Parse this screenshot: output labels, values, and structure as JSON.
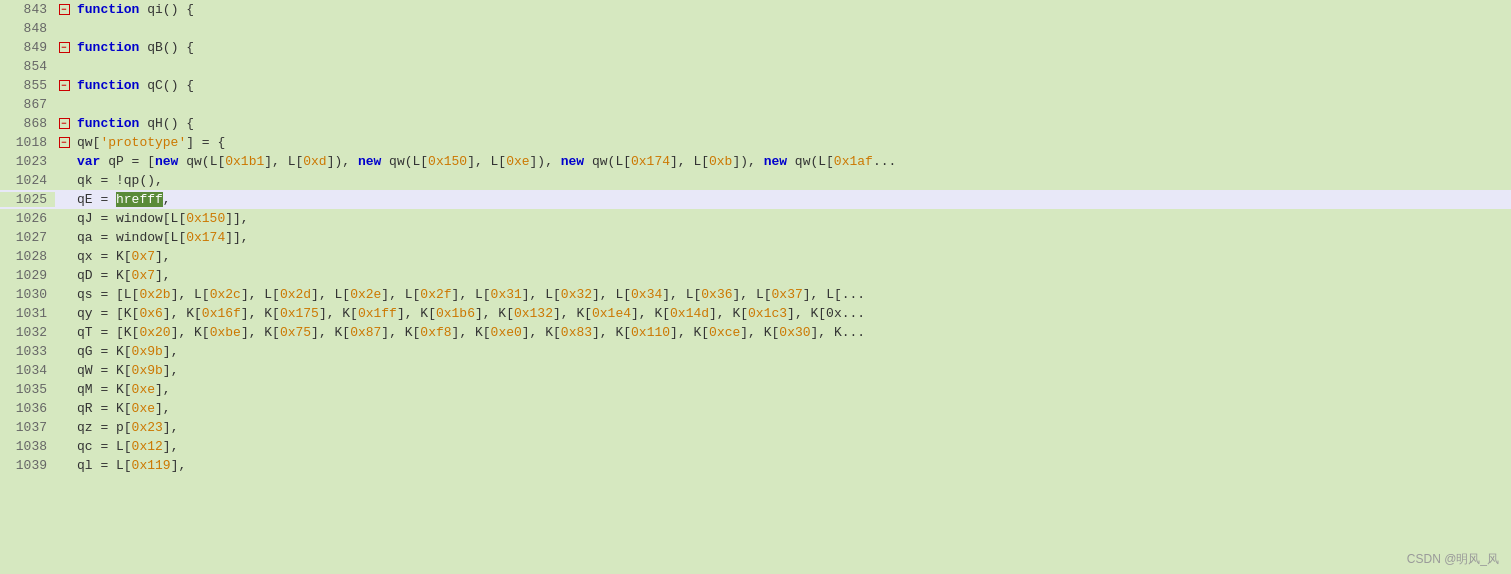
{
  "editor": {
    "lines": [
      {
        "num": "843",
        "fold": true,
        "indent": "                        ",
        "content": [
          {
            "type": "kw",
            "text": "function"
          },
          {
            "type": "plain",
            "text": " qi() {"
          }
        ]
      },
      {
        "num": "848",
        "fold": false,
        "indent": "",
        "content": []
      },
      {
        "num": "849",
        "fold": true,
        "indent": "                        ",
        "content": [
          {
            "type": "kw",
            "text": "function"
          },
          {
            "type": "plain",
            "text": " qB() {"
          }
        ]
      },
      {
        "num": "854",
        "fold": false,
        "indent": "",
        "content": []
      },
      {
        "num": "855",
        "fold": true,
        "indent": "                        ",
        "content": [
          {
            "type": "kw",
            "text": "function"
          },
          {
            "type": "plain",
            "text": " qC() {"
          }
        ]
      },
      {
        "num": "867",
        "fold": false,
        "indent": "",
        "content": []
      },
      {
        "num": "868",
        "fold": true,
        "indent": "                        ",
        "content": [
          {
            "type": "kw",
            "text": "function"
          },
          {
            "type": "plain",
            "text": " qH() {"
          }
        ]
      },
      {
        "num": "1018",
        "fold": true,
        "indent": "                        ",
        "content": [
          {
            "type": "plain",
            "text": "qw["
          },
          {
            "type": "str",
            "text": "'prototype'"
          },
          {
            "type": "plain",
            "text": "] = {"
          }
        ]
      },
      {
        "num": "1023",
        "fold": false,
        "indent": "                            ",
        "content": [
          {
            "type": "kw",
            "text": "var"
          },
          {
            "type": "plain",
            "text": " qP = ["
          },
          {
            "type": "kw",
            "text": "new"
          },
          {
            "type": "plain",
            "text": " qw(L["
          },
          {
            "type": "hex",
            "text": "0x1b1"
          },
          {
            "type": "plain",
            "text": "], L["
          },
          {
            "type": "hex",
            "text": "0xd"
          },
          {
            "type": "plain",
            "text": "]),  "
          },
          {
            "type": "kw",
            "text": "new"
          },
          {
            "type": "plain",
            "text": " qw(L["
          },
          {
            "type": "hex",
            "text": "0x150"
          },
          {
            "type": "plain",
            "text": "], L["
          },
          {
            "type": "hex",
            "text": "0xe"
          },
          {
            "type": "plain",
            "text": "]),  "
          },
          {
            "type": "kw",
            "text": "new"
          },
          {
            "type": "plain",
            "text": " qw(L["
          },
          {
            "type": "hex",
            "text": "0x174"
          },
          {
            "type": "plain",
            "text": "], L["
          },
          {
            "type": "hex",
            "text": "0xb"
          },
          {
            "type": "plain",
            "text": "]),  "
          },
          {
            "type": "kw",
            "text": "new"
          },
          {
            "type": "plain",
            "text": " qw(L["
          },
          {
            "type": "hex",
            "text": "0x1af"
          },
          {
            "type": "plain",
            "text": "..."
          }
        ]
      },
      {
        "num": "1024",
        "fold": false,
        "indent": "                                ",
        "content": [
          {
            "type": "plain",
            "text": "qk = !qp(),"
          }
        ]
      },
      {
        "num": "1025",
        "fold": false,
        "indent": "                                ",
        "highlight": true,
        "content": [
          {
            "type": "plain",
            "text": "qE = "
          },
          {
            "type": "highlight",
            "text": "hrefff"
          },
          {
            "type": "plain",
            "text": ","
          }
        ]
      },
      {
        "num": "1026",
        "fold": false,
        "indent": "                                ",
        "content": [
          {
            "type": "plain",
            "text": "qJ = window[L["
          },
          {
            "type": "hex",
            "text": "0x150"
          },
          {
            "type": "plain",
            "text": "]],"
          }
        ]
      },
      {
        "num": "1027",
        "fold": false,
        "indent": "                                ",
        "content": [
          {
            "type": "plain",
            "text": "qa = window[L["
          },
          {
            "type": "hex",
            "text": "0x174"
          },
          {
            "type": "plain",
            "text": "]],"
          }
        ]
      },
      {
        "num": "1028",
        "fold": false,
        "indent": "                                ",
        "content": [
          {
            "type": "plain",
            "text": "qx = K["
          },
          {
            "type": "hex",
            "text": "0x7"
          },
          {
            "type": "plain",
            "text": "],"
          }
        ]
      },
      {
        "num": "1029",
        "fold": false,
        "indent": "                                ",
        "content": [
          {
            "type": "plain",
            "text": "qD = K["
          },
          {
            "type": "hex",
            "text": "0x7"
          },
          {
            "type": "plain",
            "text": "],"
          }
        ]
      },
      {
        "num": "1030",
        "fold": false,
        "indent": "                                ",
        "content": [
          {
            "type": "plain",
            "text": "qs = [L["
          },
          {
            "type": "hex",
            "text": "0x2b"
          },
          {
            "type": "plain",
            "text": "], L["
          },
          {
            "type": "hex",
            "text": "0x2c"
          },
          {
            "type": "plain",
            "text": "], L["
          },
          {
            "type": "hex",
            "text": "0x2d"
          },
          {
            "type": "plain",
            "text": "], L["
          },
          {
            "type": "hex",
            "text": "0x2e"
          },
          {
            "type": "plain",
            "text": "], L["
          },
          {
            "type": "hex",
            "text": "0x2f"
          },
          {
            "type": "plain",
            "text": "], L["
          },
          {
            "type": "hex",
            "text": "0x31"
          },
          {
            "type": "plain",
            "text": "], L["
          },
          {
            "type": "hex",
            "text": "0x32"
          },
          {
            "type": "plain",
            "text": "], L["
          },
          {
            "type": "hex",
            "text": "0x34"
          },
          {
            "type": "plain",
            "text": "], L["
          },
          {
            "type": "hex",
            "text": "0x36"
          },
          {
            "type": "plain",
            "text": "], L["
          },
          {
            "type": "hex",
            "text": "0x37"
          },
          {
            "type": "plain",
            "text": "], L[..."
          }
        ]
      },
      {
        "num": "1031",
        "fold": false,
        "indent": "                                ",
        "content": [
          {
            "type": "plain",
            "text": "qy = [K["
          },
          {
            "type": "hex",
            "text": "0x6"
          },
          {
            "type": "plain",
            "text": "], K["
          },
          {
            "type": "hex",
            "text": "0x16f"
          },
          {
            "type": "plain",
            "text": "], K["
          },
          {
            "type": "hex",
            "text": "0x175"
          },
          {
            "type": "plain",
            "text": "], K["
          },
          {
            "type": "hex",
            "text": "0x1ff"
          },
          {
            "type": "plain",
            "text": "], K["
          },
          {
            "type": "hex",
            "text": "0x1b6"
          },
          {
            "type": "plain",
            "text": "], K["
          },
          {
            "type": "hex",
            "text": "0x132"
          },
          {
            "type": "plain",
            "text": "], K["
          },
          {
            "type": "hex",
            "text": "0x1e4"
          },
          {
            "type": "plain",
            "text": "], K["
          },
          {
            "type": "hex",
            "text": "0x14d"
          },
          {
            "type": "plain",
            "text": "], K["
          },
          {
            "type": "hex",
            "text": "0x1c3"
          },
          {
            "type": "plain",
            "text": "], K[0x..."
          }
        ]
      },
      {
        "num": "1032",
        "fold": false,
        "indent": "                                ",
        "content": [
          {
            "type": "plain",
            "text": "qT = [K["
          },
          {
            "type": "hex",
            "text": "0x20"
          },
          {
            "type": "plain",
            "text": "], K["
          },
          {
            "type": "hex",
            "text": "0xbe"
          },
          {
            "type": "plain",
            "text": "], K["
          },
          {
            "type": "hex",
            "text": "0x75"
          },
          {
            "type": "plain",
            "text": "], K["
          },
          {
            "type": "hex",
            "text": "0x87"
          },
          {
            "type": "plain",
            "text": "], K["
          },
          {
            "type": "hex",
            "text": "0xf8"
          },
          {
            "type": "plain",
            "text": "], K["
          },
          {
            "type": "hex",
            "text": "0xe0"
          },
          {
            "type": "plain",
            "text": "], K["
          },
          {
            "type": "hex",
            "text": "0x83"
          },
          {
            "type": "plain",
            "text": "], K["
          },
          {
            "type": "hex",
            "text": "0x110"
          },
          {
            "type": "plain",
            "text": "], K["
          },
          {
            "type": "hex",
            "text": "0xce"
          },
          {
            "type": "plain",
            "text": "], K["
          },
          {
            "type": "hex",
            "text": "0x30"
          },
          {
            "type": "plain",
            "text": "], K..."
          }
        ]
      },
      {
        "num": "1033",
        "fold": false,
        "indent": "                                ",
        "content": [
          {
            "type": "plain",
            "text": "qG = K["
          },
          {
            "type": "hex",
            "text": "0x9b"
          },
          {
            "type": "plain",
            "text": "],"
          }
        ]
      },
      {
        "num": "1034",
        "fold": false,
        "indent": "                                ",
        "content": [
          {
            "type": "plain",
            "text": "qW = K["
          },
          {
            "type": "hex",
            "text": "0x9b"
          },
          {
            "type": "plain",
            "text": "],"
          }
        ]
      },
      {
        "num": "1035",
        "fold": false,
        "indent": "                                ",
        "content": [
          {
            "type": "plain",
            "text": "qM = K["
          },
          {
            "type": "hex",
            "text": "0xe"
          },
          {
            "type": "plain",
            "text": "],"
          }
        ]
      },
      {
        "num": "1036",
        "fold": false,
        "indent": "                                ",
        "content": [
          {
            "type": "plain",
            "text": "qR = K["
          },
          {
            "type": "hex",
            "text": "0xe"
          },
          {
            "type": "plain",
            "text": "],"
          }
        ]
      },
      {
        "num": "1037",
        "fold": false,
        "indent": "                                ",
        "content": [
          {
            "type": "plain",
            "text": "qz = p["
          },
          {
            "type": "hex",
            "text": "0x23"
          },
          {
            "type": "plain",
            "text": "],"
          }
        ]
      },
      {
        "num": "1038",
        "fold": false,
        "indent": "                                ",
        "content": [
          {
            "type": "plain",
            "text": "qc = L["
          },
          {
            "type": "hex",
            "text": "0x12"
          },
          {
            "type": "plain",
            "text": "],"
          }
        ]
      },
      {
        "num": "1039",
        "fold": false,
        "indent": "                                ",
        "content": [
          {
            "type": "plain",
            "text": "ql = L["
          },
          {
            "type": "hex",
            "text": "0x119"
          },
          {
            "type": "plain",
            "text": "],"
          }
        ]
      }
    ],
    "watermark": "CSDN @明风_风"
  }
}
